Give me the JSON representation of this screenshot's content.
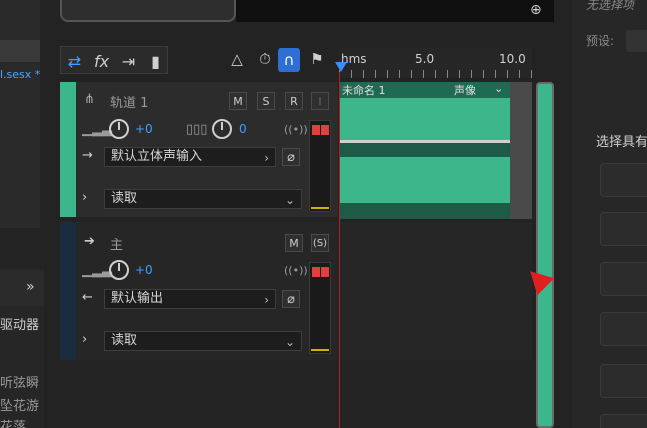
{
  "left": {
    "filename": "l.sesx *",
    "driver_label": "驱动器",
    "list": [
      "听弦瞬",
      "坠花游",
      "花落"
    ]
  },
  "toolbar": {
    "tab_icons": [
      "multitrack-icon",
      "fx-icon",
      "send-icon",
      "bars-icon"
    ],
    "fx_label": "fx"
  },
  "ruler": {
    "unit": "hms",
    "ticks": [
      "5.0",
      "10.0"
    ]
  },
  "track1": {
    "name": "轨道 1",
    "mute": "M",
    "solo": "S",
    "record": "R",
    "monitor": "I",
    "volume": "+0",
    "pan": "0",
    "input": "默认立体声输入",
    "automation": "读取"
  },
  "clip": {
    "title": "未命名 1",
    "mode": "声像"
  },
  "master": {
    "name": "主",
    "mute": "M",
    "solo": "(S)",
    "volume": "+0",
    "output": "默认输出",
    "automation": "读取"
  },
  "right": {
    "header": "无选择项",
    "preset_label": "预设:",
    "hint": "选择具有"
  },
  "colors": {
    "accent_green": "#3cb68b",
    "accent_blue": "#3fa0ff",
    "annotation_red": "#e02020"
  }
}
